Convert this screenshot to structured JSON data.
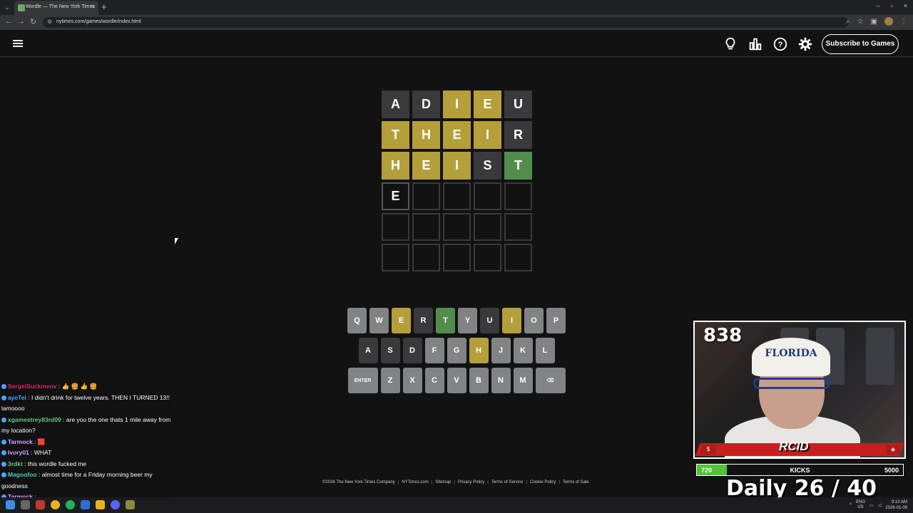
{
  "browser": {
    "tab_title": "Wordle — The New York Times",
    "url": "nytimes.com/games/wordle/index.html"
  },
  "header": {
    "subscribe_label": "Subscribe to Games",
    "icons": [
      "menu-icon",
      "hint-bulb-icon",
      "stats-icon",
      "help-icon",
      "settings-icon"
    ]
  },
  "board": {
    "rows": [
      [
        {
          "l": "A",
          "s": "absent"
        },
        {
          "l": "D",
          "s": "absent"
        },
        {
          "l": "I",
          "s": "present"
        },
        {
          "l": "E",
          "s": "present"
        },
        {
          "l": "U",
          "s": "absent"
        }
      ],
      [
        {
          "l": "T",
          "s": "present"
        },
        {
          "l": "H",
          "s": "present"
        },
        {
          "l": "E",
          "s": "present"
        },
        {
          "l": "I",
          "s": "present"
        },
        {
          "l": "R",
          "s": "absent"
        }
      ],
      [
        {
          "l": "H",
          "s": "present"
        },
        {
          "l": "E",
          "s": "present"
        },
        {
          "l": "I",
          "s": "present"
        },
        {
          "l": "S",
          "s": "absent"
        },
        {
          "l": "T",
          "s": "correct"
        }
      ],
      [
        {
          "l": "E",
          "s": "tbd"
        },
        {
          "l": "",
          "s": "empty"
        },
        {
          "l": "",
          "s": "empty"
        },
        {
          "l": "",
          "s": "empty"
        },
        {
          "l": "",
          "s": "empty"
        }
      ],
      [
        {
          "l": "",
          "s": "empty"
        },
        {
          "l": "",
          "s": "empty"
        },
        {
          "l": "",
          "s": "empty"
        },
        {
          "l": "",
          "s": "empty"
        },
        {
          "l": "",
          "s": "empty"
        }
      ],
      [
        {
          "l": "",
          "s": "empty"
        },
        {
          "l": "",
          "s": "empty"
        },
        {
          "l": "",
          "s": "empty"
        },
        {
          "l": "",
          "s": "empty"
        },
        {
          "l": "",
          "s": "empty"
        }
      ]
    ],
    "colors": {
      "absent": "#3a3a3c",
      "present": "#b59f3b",
      "correct": "#538d4e"
    }
  },
  "keyboard": {
    "rows": [
      [
        {
          "k": "Q",
          "s": "unused"
        },
        {
          "k": "W",
          "s": "unused"
        },
        {
          "k": "E",
          "s": "present"
        },
        {
          "k": "R",
          "s": "absent"
        },
        {
          "k": "T",
          "s": "correct"
        },
        {
          "k": "Y",
          "s": "unused"
        },
        {
          "k": "U",
          "s": "absent"
        },
        {
          "k": "I",
          "s": "present"
        },
        {
          "k": "O",
          "s": "unused"
        },
        {
          "k": "P",
          "s": "unused"
        }
      ],
      [
        {
          "k": "A",
          "s": "absent"
        },
        {
          "k": "S",
          "s": "absent"
        },
        {
          "k": "D",
          "s": "absent"
        },
        {
          "k": "F",
          "s": "unused"
        },
        {
          "k": "G",
          "s": "unused"
        },
        {
          "k": "H",
          "s": "present"
        },
        {
          "k": "J",
          "s": "unused"
        },
        {
          "k": "K",
          "s": "unused"
        },
        {
          "k": "L",
          "s": "unused"
        }
      ],
      [
        {
          "k": "ENTER",
          "s": "unused",
          "wide": true
        },
        {
          "k": "Z",
          "s": "unused"
        },
        {
          "k": "X",
          "s": "unused"
        },
        {
          "k": "C",
          "s": "unused"
        },
        {
          "k": "V",
          "s": "unused"
        },
        {
          "k": "B",
          "s": "unused"
        },
        {
          "k": "N",
          "s": "unused"
        },
        {
          "k": "M",
          "s": "unused"
        },
        {
          "k": "⌫",
          "s": "unused",
          "wide": true,
          "name": "backspace-key"
        }
      ]
    ]
  },
  "footer": {
    "links": [
      "©2026 The New York Times Company",
      "NYTimes.com",
      "Sitemap",
      "Privacy Policy",
      "Terms of Service",
      "Cookie Policy",
      "Terms of Sale"
    ]
  },
  "chat": {
    "messages": [
      {
        "user": "SergeiSuckmeov",
        "color": "#e0245e",
        "text": "👍 🍔 👍 🍔"
      },
      {
        "user": "ayeTel",
        "color": "#4aa3ff",
        "text": "I didn't drink for twelve years. THEN I TURNED 13!! lamoooo"
      },
      {
        "user": "xgamestrey83rd09",
        "color": "#6cc77a",
        "text": "are you the one thats 1 mile away from my location?"
      },
      {
        "user": "Tarmock",
        "color": "#d6a0ff",
        "text": "🟥"
      },
      {
        "user": "Ivory01",
        "color": "#c8a2ff",
        "text": "WHAT"
      },
      {
        "user": "3rdkt",
        "color": "#6cc77a",
        "text": "this wordle fucked me"
      },
      {
        "user": "Magoofoo",
        "color": "#52c7c0",
        "text": "almost time for a Friday morning beer my goodness"
      },
      {
        "user": "Tarmock",
        "color": "#d6a0ff",
        "text": ""
      }
    ]
  },
  "stream": {
    "counter": "838",
    "cap_text": "FLORIDA",
    "logo_text": "RCID",
    "kicks": {
      "current": "720",
      "label": "KICKS",
      "goal": "5000",
      "fraction": 0.144
    },
    "daily_text": "Daily  26 / 40",
    "accent": "#c81e1e",
    "kicks_color": "#53c23a"
  },
  "taskbar": {
    "lang_line1": "ENG",
    "lang_line2": "US",
    "time": "9:10 AM",
    "date": "2026-01-09"
  }
}
